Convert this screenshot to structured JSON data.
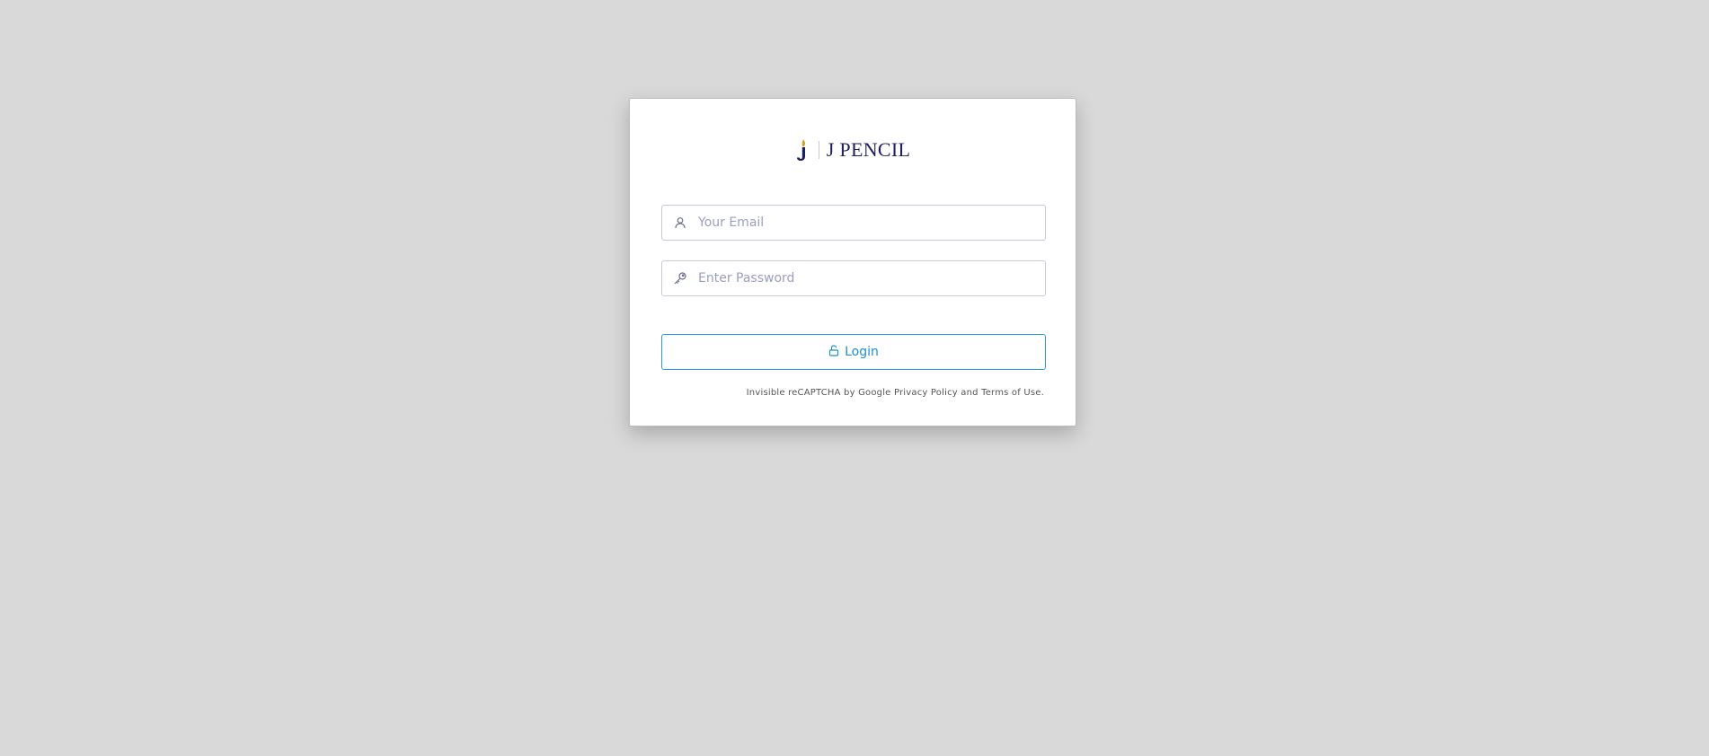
{
  "brand": {
    "name": "J PENCIL",
    "mark_colors": {
      "letter": "#1d1f5e",
      "flame": "#d4a22a"
    }
  },
  "form": {
    "email": {
      "placeholder": "Your Email",
      "value": "",
      "icon": "user-icon"
    },
    "password": {
      "placeholder": "Enter Password",
      "value": "",
      "icon": "key-icon"
    },
    "login": {
      "label": "Login",
      "icon": "unlock-icon"
    }
  },
  "recaptcha": {
    "prefix": "Invisible reCAPTCHA by Google",
    "privacy_label": "Privacy Policy",
    "and": "and",
    "terms_label": "Terms of Use."
  },
  "colors": {
    "background": "#d9d9d9",
    "accent": "#1e8fce",
    "input_border": "#c8c9d6",
    "placeholder": "#9a9ec0"
  }
}
